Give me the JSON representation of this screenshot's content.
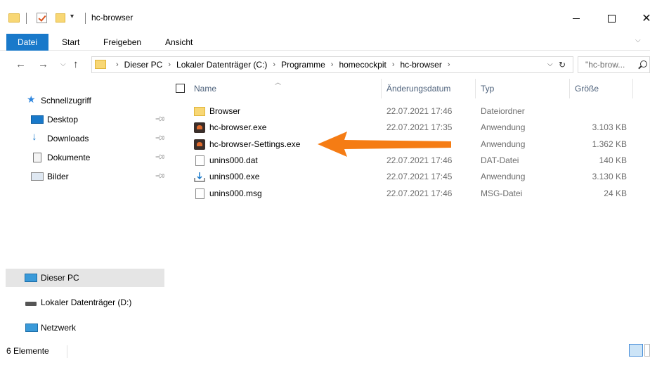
{
  "window": {
    "title": "hc-browser",
    "quick_access_dropdown": "▾"
  },
  "ribbon": {
    "tabs": [
      "Datei",
      "Start",
      "Freigeben",
      "Ansicht"
    ]
  },
  "address": {
    "crumbs": [
      "Dieser PC",
      "Lokaler Datenträger (C:)",
      "Programme",
      "homecockpit",
      "hc-browser"
    ],
    "search_placeholder": "\"hc-brow..."
  },
  "sidebar": {
    "quick_access": "Schnellzugriff",
    "items": [
      {
        "label": "Desktop",
        "icon": "desktop-icon",
        "pinned": true
      },
      {
        "label": "Downloads",
        "icon": "downloads-icon",
        "pinned": true
      },
      {
        "label": "Dokumente",
        "icon": "documents-icon",
        "pinned": true
      },
      {
        "label": "Bilder",
        "icon": "pictures-icon",
        "pinned": true
      }
    ],
    "this_pc": "Dieser PC",
    "drive_d": "Lokaler Datenträger (D:)",
    "network": "Netzwerk"
  },
  "columns": {
    "name": "Name",
    "date": "Änderungsdatum",
    "type": "Typ",
    "size": "Größe"
  },
  "files": [
    {
      "name": "Browser",
      "date": "22.07.2021 17:46",
      "type": "Dateiordner",
      "size": "",
      "icon": "folder-icon"
    },
    {
      "name": "hc-browser.exe",
      "date": "22.07.2021 17:35",
      "type": "Anwendung",
      "size": "3.103 KB",
      "icon": "app-icon"
    },
    {
      "name": "hc-browser-Settings.exe",
      "date": "",
      "type": "Anwendung",
      "size": "1.362 KB",
      "icon": "app-icon"
    },
    {
      "name": "unins000.dat",
      "date": "22.07.2021 17:46",
      "type": "DAT-Datei",
      "size": "140 KB",
      "icon": "file-icon"
    },
    {
      "name": "unins000.exe",
      "date": "22.07.2021 17:45",
      "type": "Anwendung",
      "size": "3.130 KB",
      "icon": "setup-icon"
    },
    {
      "name": "unins000.msg",
      "date": "22.07.2021 17:46",
      "type": "MSG-Datei",
      "size": "24 KB",
      "icon": "file-icon"
    }
  ],
  "annotation": {
    "arrow_color": "#f57c14"
  },
  "status": {
    "count": "6 Elemente"
  },
  "colors": {
    "accent": "#1979ca",
    "selected_nav": "#e5e5e5",
    "folder": "#f8d775"
  }
}
